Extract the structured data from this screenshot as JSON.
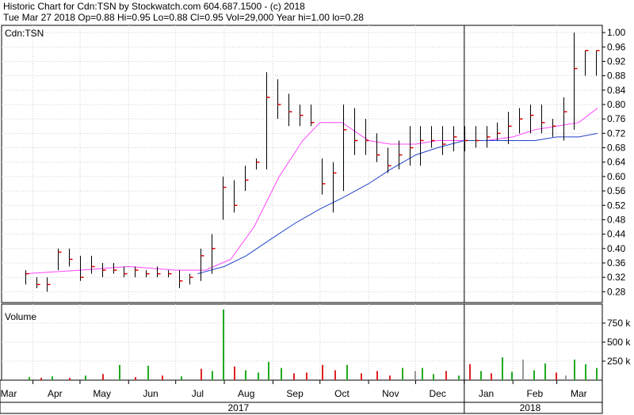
{
  "header": {
    "line1": "Historic Chart for Cdn:TSN by Stockwatch.com 604.687.1500 - (c) 2018",
    "line2": "Tue Mar 27 2018  Op=0.88  Hi=0.95  Lo=0.88  Cl=0.95  Vol=29,000  Year hi=1.00  lo=0.28"
  },
  "colors": {
    "price_bar": "#000000",
    "close_tick": "#e00000",
    "short_ma": "#ff44ff",
    "long_ma": "#2244cc",
    "volume_up": "#22aa22",
    "volume_down": "#dd2222",
    "volume_flat": "#999999",
    "grid": "#cfcfcf"
  },
  "chart_data": [
    {
      "type": "line",
      "title": "Cdn:TSN",
      "subtype": "ohlc",
      "y_ticks": [
        "0.28",
        "0.32",
        "0.36",
        "0.40",
        "0.44",
        "0.48",
        "0.52",
        "0.56",
        "0.60",
        "0.64",
        "0.68",
        "0.72",
        "0.76",
        "0.80",
        "0.84",
        "0.88",
        "0.92",
        "0.96",
        "1.00"
      ],
      "ylim": [
        0.25,
        1.02
      ],
      "x_month_labels": [
        "Mar",
        "Apr",
        "May",
        "Jun",
        "Jul",
        "Aug",
        "Sep",
        "Oct",
        "Nov",
        "Dec",
        "Jan",
        "Feb",
        "Mar"
      ],
      "x_year_labels": [
        "2017",
        "2018"
      ],
      "grid": true,
      "series": [
        {
          "kind": "weekly_ohlc",
          "x": [
            "2017-03-27",
            "2017-04-03",
            "2017-04-10",
            "2017-04-17",
            "2017-04-24",
            "2017-05-01",
            "2017-05-08",
            "2017-05-15",
            "2017-05-22",
            "2017-05-29",
            "2017-06-05",
            "2017-06-12",
            "2017-06-19",
            "2017-06-26",
            "2017-07-03",
            "2017-07-10",
            "2017-07-17",
            "2017-07-24",
            "2017-07-31",
            "2017-08-07",
            "2017-08-14",
            "2017-08-21",
            "2017-08-28",
            "2017-09-04",
            "2017-09-11",
            "2017-09-18",
            "2017-09-25",
            "2017-10-02",
            "2017-10-09",
            "2017-10-16",
            "2017-10-23",
            "2017-10-30",
            "2017-11-06",
            "2017-11-13",
            "2017-11-20",
            "2017-11-27",
            "2017-12-04",
            "2017-12-11",
            "2017-12-18",
            "2017-12-25",
            "2018-01-01",
            "2018-01-08",
            "2018-01-15",
            "2018-01-22",
            "2018-01-29",
            "2018-02-05",
            "2018-02-12",
            "2018-02-19",
            "2018-02-26",
            "2018-03-05",
            "2018-03-12",
            "2018-03-19",
            "2018-03-26"
          ],
          "high": [
            0.34,
            0.32,
            0.32,
            0.4,
            0.4,
            0.38,
            0.38,
            0.36,
            0.36,
            0.35,
            0.35,
            0.34,
            0.35,
            0.34,
            0.34,
            0.33,
            0.4,
            0.44,
            0.6,
            0.59,
            0.63,
            0.65,
            0.89,
            0.87,
            0.83,
            0.8,
            0.8,
            0.65,
            0.64,
            0.8,
            0.79,
            0.76,
            0.72,
            0.68,
            0.7,
            0.74,
            0.74,
            0.74,
            0.74,
            0.74,
            0.74,
            0.74,
            0.74,
            0.75,
            0.78,
            0.79,
            0.8,
            0.8,
            0.76,
            0.82,
            1.0,
            0.95,
            0.95
          ],
          "low": [
            0.3,
            0.29,
            0.28,
            0.34,
            0.35,
            0.31,
            0.33,
            0.32,
            0.33,
            0.32,
            0.32,
            0.32,
            0.32,
            0.32,
            0.29,
            0.3,
            0.31,
            0.33,
            0.48,
            0.5,
            0.56,
            0.62,
            0.62,
            0.76,
            0.74,
            0.74,
            0.74,
            0.55,
            0.5,
            0.56,
            0.66,
            0.66,
            0.64,
            0.61,
            0.62,
            0.63,
            0.63,
            0.68,
            0.66,
            0.67,
            0.67,
            0.68,
            0.68,
            0.7,
            0.69,
            0.72,
            0.72,
            0.72,
            0.71,
            0.7,
            0.73,
            0.88,
            0.88
          ],
          "close": [
            0.33,
            0.3,
            0.3,
            0.39,
            0.37,
            0.32,
            0.35,
            0.34,
            0.34,
            0.33,
            0.34,
            0.33,
            0.33,
            0.33,
            0.31,
            0.32,
            0.38,
            0.4,
            0.57,
            0.52,
            0.59,
            0.64,
            0.82,
            0.8,
            0.78,
            0.77,
            0.75,
            0.58,
            0.61,
            0.73,
            0.7,
            0.7,
            0.66,
            0.63,
            0.66,
            0.68,
            0.7,
            0.7,
            0.69,
            0.71,
            0.7,
            0.7,
            0.71,
            0.72,
            0.74,
            0.76,
            0.77,
            0.75,
            0.74,
            0.78,
            0.9,
            0.95,
            0.95
          ]
        },
        {
          "name": "short_ma",
          "x": [
            "2017-03-27",
            "2017-05-01",
            "2017-06-01",
            "2017-07-01",
            "2017-07-20",
            "2017-08-05",
            "2017-08-20",
            "2017-09-05",
            "2017-09-20",
            "2017-10-01",
            "2017-10-15",
            "2017-11-01",
            "2017-11-15",
            "2017-12-01",
            "2017-12-15",
            "2018-01-01",
            "2018-01-15",
            "2018-02-01",
            "2018-02-15",
            "2018-03-01",
            "2018-03-15",
            "2018-03-27"
          ],
          "values": [
            0.33,
            0.34,
            0.35,
            0.34,
            0.34,
            0.37,
            0.46,
            0.6,
            0.7,
            0.75,
            0.75,
            0.7,
            0.69,
            0.69,
            0.7,
            0.7,
            0.7,
            0.71,
            0.73,
            0.74,
            0.75,
            0.79
          ]
        },
        {
          "name": "long_ma",
          "x": [
            "2017-07-15",
            "2017-08-01",
            "2017-08-15",
            "2017-09-01",
            "2017-09-15",
            "2017-10-01",
            "2017-10-15",
            "2017-11-01",
            "2017-11-15",
            "2017-12-01",
            "2017-12-15",
            "2018-01-01",
            "2018-01-15",
            "2018-02-01",
            "2018-02-15",
            "2018-03-01",
            "2018-03-15",
            "2018-03-27"
          ],
          "values": [
            0.33,
            0.35,
            0.38,
            0.43,
            0.47,
            0.51,
            0.54,
            0.58,
            0.62,
            0.66,
            0.68,
            0.7,
            0.7,
            0.7,
            0.7,
            0.71,
            0.71,
            0.72
          ]
        }
      ]
    },
    {
      "type": "bar",
      "title": "Volume",
      "y_ticks": [
        "250 k",
        "500 k",
        "750 k"
      ],
      "ylim": [
        0,
        1000000
      ],
      "bars": [
        {
          "date": "2017-03-29",
          "v": 40000,
          "c": "volume_up"
        },
        {
          "date": "2017-04-06",
          "v": 30000,
          "c": "volume_down"
        },
        {
          "date": "2017-04-13",
          "v": 50000,
          "c": "volume_up"
        },
        {
          "date": "2017-04-24",
          "v": 30000,
          "c": "volume_down"
        },
        {
          "date": "2017-05-04",
          "v": 60000,
          "c": "volume_up"
        },
        {
          "date": "2017-05-15",
          "v": 80000,
          "c": "volume_down"
        },
        {
          "date": "2017-05-26",
          "v": 200000,
          "c": "volume_up"
        },
        {
          "date": "2017-06-05",
          "v": 40000,
          "c": "volume_down"
        },
        {
          "date": "2017-06-13",
          "v": 190000,
          "c": "volume_up"
        },
        {
          "date": "2017-06-22",
          "v": 60000,
          "c": "volume_down"
        },
        {
          "date": "2017-07-04",
          "v": 50000,
          "c": "volume_up"
        },
        {
          "date": "2017-07-17",
          "v": 150000,
          "c": "volume_down"
        },
        {
          "date": "2017-07-24",
          "v": 120000,
          "c": "volume_up"
        },
        {
          "date": "2017-07-31",
          "v": 930000,
          "c": "volume_up"
        },
        {
          "date": "2017-08-07",
          "v": 180000,
          "c": "volume_down"
        },
        {
          "date": "2017-08-14",
          "v": 130000,
          "c": "volume_up"
        },
        {
          "date": "2017-08-22",
          "v": 100000,
          "c": "volume_up"
        },
        {
          "date": "2017-08-29",
          "v": 240000,
          "c": "volume_up"
        },
        {
          "date": "2017-09-06",
          "v": 160000,
          "c": "volume_up"
        },
        {
          "date": "2017-09-14",
          "v": 90000,
          "c": "volume_down"
        },
        {
          "date": "2017-09-22",
          "v": 100000,
          "c": "volume_down"
        },
        {
          "date": "2017-10-02",
          "v": 200000,
          "c": "volume_down"
        },
        {
          "date": "2017-10-10",
          "v": 130000,
          "c": "volume_down"
        },
        {
          "date": "2017-10-18",
          "v": 200000,
          "c": "volume_up"
        },
        {
          "date": "2017-10-27",
          "v": 90000,
          "c": "volume_down"
        },
        {
          "date": "2017-11-06",
          "v": 120000,
          "c": "volume_down"
        },
        {
          "date": "2017-11-14",
          "v": 60000,
          "c": "volume_down"
        },
        {
          "date": "2017-11-22",
          "v": 160000,
          "c": "volume_up"
        },
        {
          "date": "2017-11-30",
          "v": 120000,
          "c": "volume_flat"
        },
        {
          "date": "2017-12-05",
          "v": 160000,
          "c": "volume_up"
        },
        {
          "date": "2017-12-12",
          "v": 80000,
          "c": "volume_up"
        },
        {
          "date": "2017-12-20",
          "v": 120000,
          "c": "volume_down"
        },
        {
          "date": "2017-12-28",
          "v": 60000,
          "c": "volume_up"
        },
        {
          "date": "2018-01-04",
          "v": 210000,
          "c": "volume_down"
        },
        {
          "date": "2018-01-11",
          "v": 120000,
          "c": "volume_up"
        },
        {
          "date": "2018-01-18",
          "v": 90000,
          "c": "volume_down"
        },
        {
          "date": "2018-01-25",
          "v": 300000,
          "c": "volume_up"
        },
        {
          "date": "2018-01-31",
          "v": 110000,
          "c": "volume_up"
        },
        {
          "date": "2018-02-07",
          "v": 270000,
          "c": "volume_flat"
        },
        {
          "date": "2018-02-14",
          "v": 130000,
          "c": "volume_up"
        },
        {
          "date": "2018-02-21",
          "v": 220000,
          "c": "volume_up"
        },
        {
          "date": "2018-02-28",
          "v": 100000,
          "c": "volume_down"
        },
        {
          "date": "2018-03-06",
          "v": 60000,
          "c": "volume_flat"
        },
        {
          "date": "2018-03-12",
          "v": 270000,
          "c": "volume_up"
        },
        {
          "date": "2018-03-19",
          "v": 210000,
          "c": "volume_up"
        },
        {
          "date": "2018-03-26",
          "v": 160000,
          "c": "volume_up"
        }
      ]
    }
  ]
}
